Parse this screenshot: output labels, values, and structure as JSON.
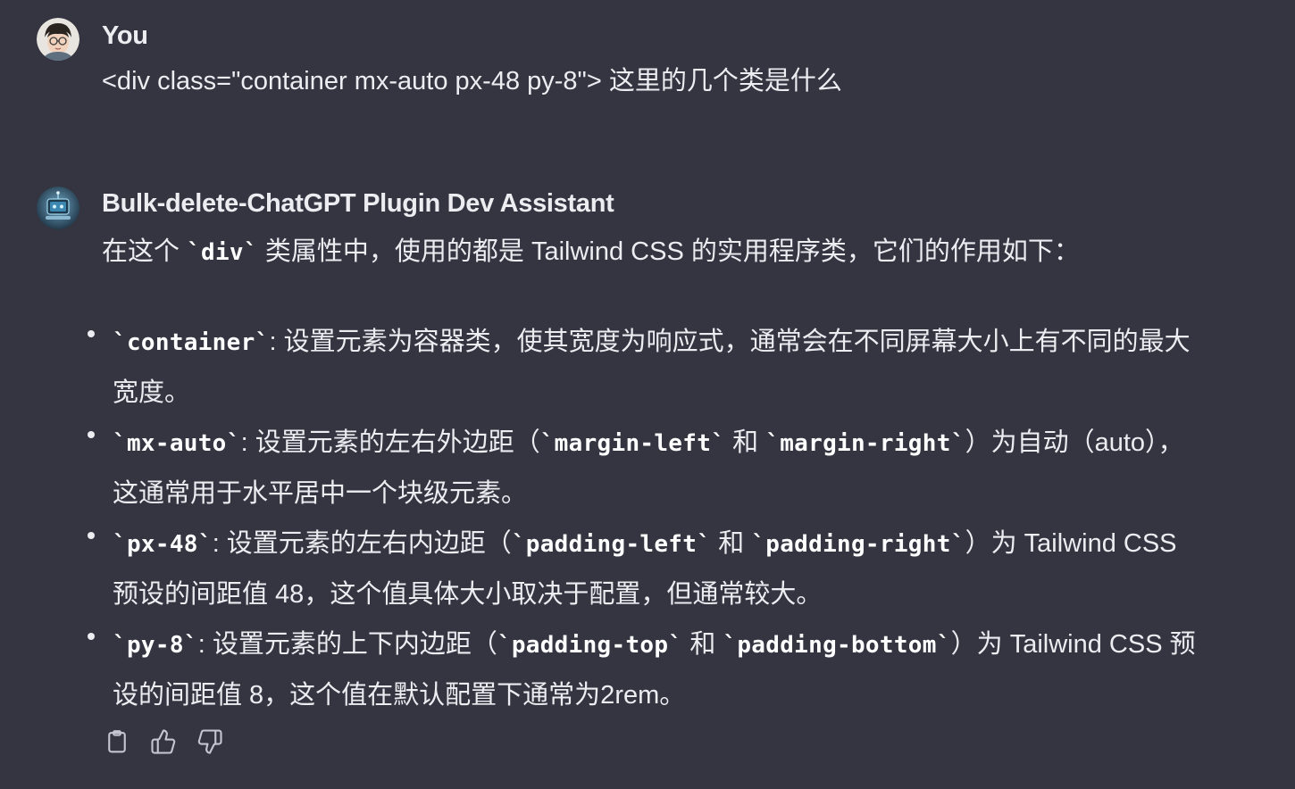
{
  "user_message": {
    "author": "You",
    "text": "<div class=\"container mx-auto px-48 py-8\"> 这里的几个类是什么"
  },
  "assistant_message": {
    "author": "Bulk-delete-ChatGPT Plugin Dev Assistant",
    "intro": {
      "before": "在这个 ",
      "code": "`div`",
      "after": " 类属性中，使用的都是 Tailwind CSS 的实用程序类，它们的作用如下："
    },
    "items": [
      {
        "code": "`container`",
        "text": ": 设置元素为容器类，使其宽度为响应式，通常会在不同屏幕大小上有不同的最大宽度。"
      },
      {
        "code": "`mx-auto`",
        "text1": ": 设置元素的左右外边距（",
        "code2": "`margin-left`",
        "text2": " 和 ",
        "code3": "`margin-right`",
        "text3": "）为自动（auto），这通常用于水平居中一个块级元素。"
      },
      {
        "code": "`px-48`",
        "text1": ": 设置元素的左右内边距（",
        "code2": "`padding-left`",
        "text2": " 和 ",
        "code3": "`padding-right`",
        "text3": "）为 Tailwind CSS 预设的间距值 48，这个值具体大小取决于配置，但通常较大。"
      },
      {
        "code": "`py-8`",
        "text1": ": 设置元素的上下内边距（",
        "code2": "`padding-top`",
        "text2": " 和 ",
        "code3": "`padding-bottom`",
        "text3": "）为 Tailwind CSS 预设的间距值 8，这个值在默认配置下通常为2rem。"
      }
    ]
  },
  "actions": {
    "copy_icon": "clipboard-icon",
    "like_icon": "thumbs-up-icon",
    "dislike_icon": "thumbs-down-icon"
  },
  "colors": {
    "background": "#343541",
    "text": "#ececf1"
  }
}
